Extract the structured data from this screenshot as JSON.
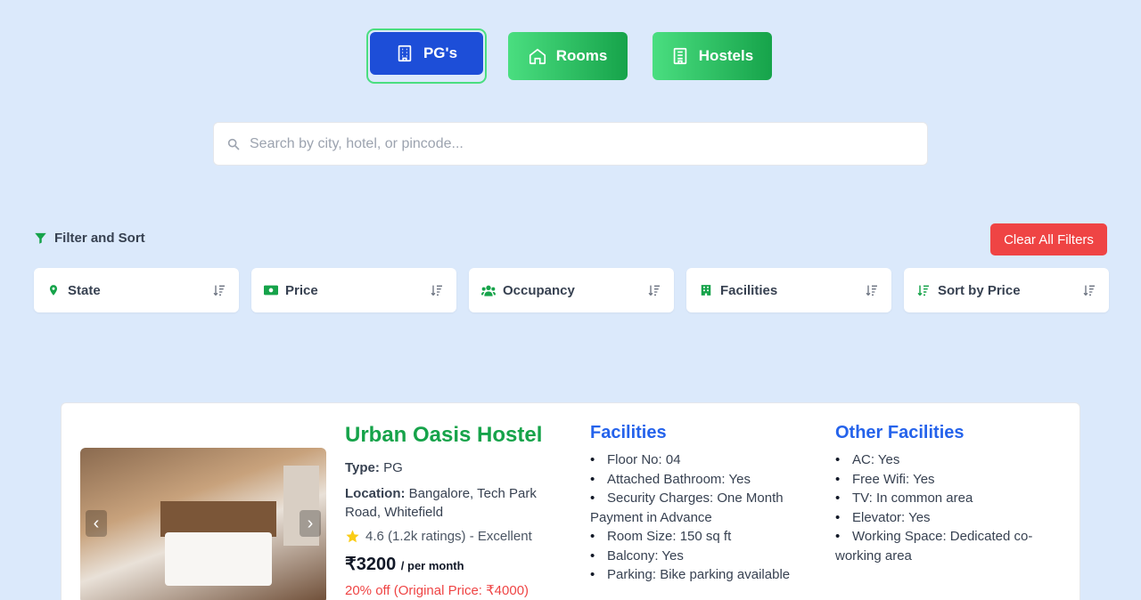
{
  "tabs": [
    {
      "label": "PG's",
      "icon": "building-icon",
      "active": true
    },
    {
      "label": "Rooms",
      "icon": "home-icon",
      "active": false
    },
    {
      "label": "Hostels",
      "icon": "hotel-icon",
      "active": false
    }
  ],
  "search": {
    "placeholder": "Search by city, hotel, or pincode..."
  },
  "filter_header": {
    "label": "Filter and Sort"
  },
  "clear_button": {
    "label": "Clear All Filters"
  },
  "filters": [
    {
      "label": "State",
      "icon": "location-pin-icon"
    },
    {
      "label": "Price",
      "icon": "money-icon"
    },
    {
      "label": "Occupancy",
      "icon": "users-icon"
    },
    {
      "label": "Facilities",
      "icon": "building-icon"
    },
    {
      "label": "Sort by Price",
      "icon": "sort-icon"
    }
  ],
  "listing": {
    "name": "Urban Oasis Hostel",
    "type_label": "Type:",
    "type_value": "PG",
    "location_label": "Location:",
    "location_value": "Bangalore, Tech Park Road, Whitefield",
    "rating_text": "4.6 (1.2k ratings) - Excellent",
    "price": "₹3200",
    "price_unit": "/ per month",
    "discount_text": "20% off (Original Price: ₹4000)",
    "facilities_title": "Facilities",
    "facilities": [
      "Floor No: 04",
      "Attached Bathroom: Yes",
      "Security Charges: One Month Payment in Advance",
      "Room Size: 150 sq ft",
      "Balcony: Yes",
      "Parking: Bike parking available"
    ],
    "other_title": "Other Facilities",
    "other_facilities": [
      "AC: Yes",
      "Free Wifi: Yes",
      "TV: In common area",
      "Elevator: Yes",
      "Working Space: Dedicated co-working area"
    ]
  },
  "colors": {
    "active_tab": "#1d4ed8",
    "green": "#16a34a",
    "danger": "#ef4444",
    "link_blue": "#2563eb",
    "background": "#dbe9fb"
  }
}
